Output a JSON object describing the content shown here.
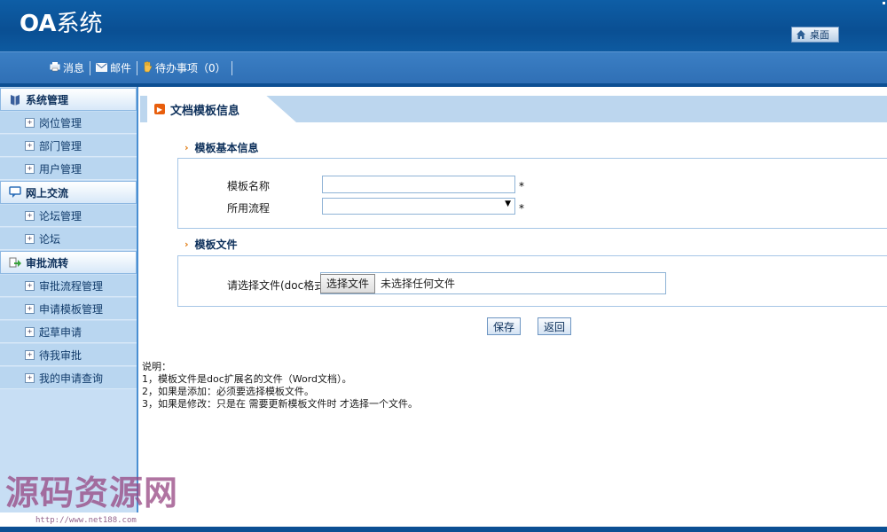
{
  "header": {
    "logo_prefix": "OA",
    "logo_suffix": "系统",
    "desk_label": "桌面"
  },
  "toolbar": {
    "messages": "消息",
    "mail": "邮件",
    "todo": "待办事项（0）"
  },
  "sidebar": {
    "groups": [
      {
        "title": "系统管理",
        "icon": "book-icon",
        "items": [
          "岗位管理",
          "部门管理",
          "用户管理"
        ]
      },
      {
        "title": "网上交流",
        "icon": "chat-icon",
        "items": [
          "论坛管理",
          "论坛"
        ]
      },
      {
        "title": "审批流转",
        "icon": "flow-arrow-icon",
        "items": [
          "审批流程管理",
          "申请模板管理",
          "起草申请",
          "待我审批",
          "我的申请查询"
        ]
      }
    ]
  },
  "main": {
    "title": "文档模板信息",
    "basic_section": "模板基本信息",
    "name_label": "模板名称",
    "flow_label": "所用流程",
    "required_mark": "*",
    "name_value": "",
    "flow_value": "",
    "file_section": "模板文件",
    "file_label": "请选择文件(doc格式)",
    "file_button": "选择文件",
    "file_status": "未选择任何文件",
    "save_button": "保存",
    "back_button": "返回",
    "notes": [
      "说明：",
      "1，模板文件是doc扩展名的文件（Word文档）。",
      "2，如果是添加：必须要选择模板文件。",
      "3，如果是修改：只是在 需要更新模板文件时 才选择一个文件。"
    ]
  },
  "watermark": {
    "title": "源码资源网",
    "url": "http://www.net188.com"
  },
  "colors": {
    "header": "#0a4f93",
    "toolbar": "#3478bd",
    "sidebar": "#c7def4",
    "accent_arrow": "#e07a10"
  }
}
